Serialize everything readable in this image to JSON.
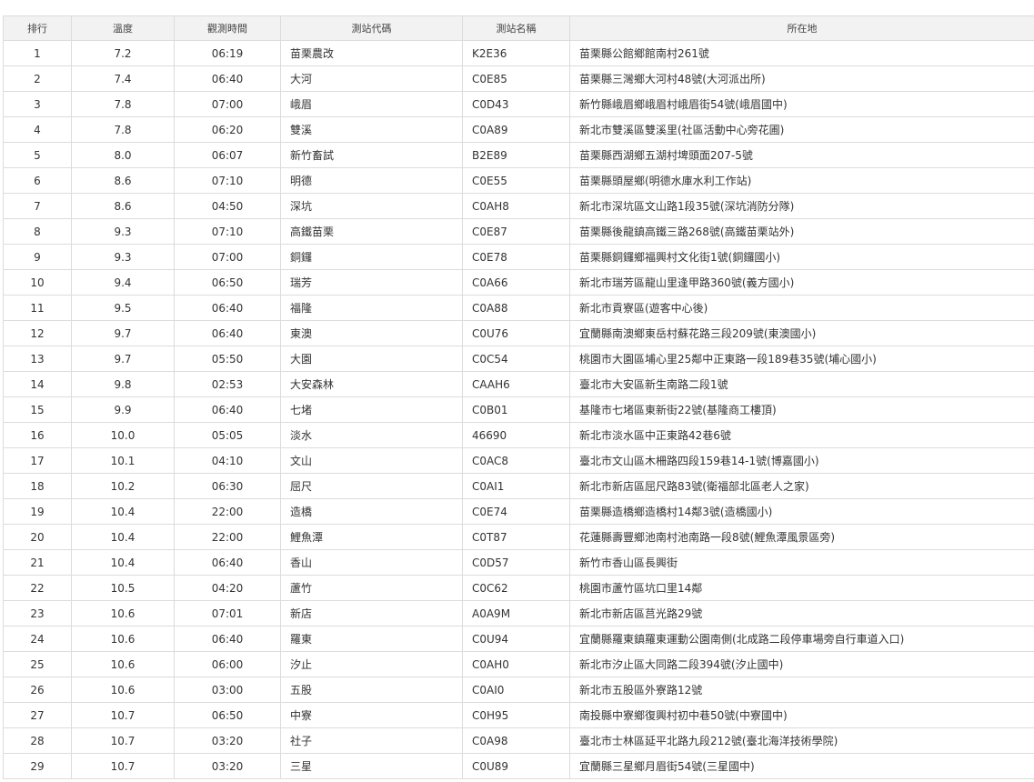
{
  "table": {
    "headers": [
      "排行",
      "溫度",
      "觀測時間",
      "測站代碼",
      "測站名稱",
      "所在地"
    ],
    "rows": [
      [
        "1",
        "7.2",
        "06:19",
        "苗栗農改",
        "K2E36",
        "苗栗縣公館鄉館南村261號"
      ],
      [
        "2",
        "7.4",
        "06:40",
        "大河",
        "C0E85",
        "苗栗縣三灣鄉大河村48號(大河派出所)"
      ],
      [
        "3",
        "7.8",
        "07:00",
        "峨眉",
        "C0D43",
        "新竹縣峨眉鄉峨眉村峨眉街54號(峨眉國中)"
      ],
      [
        "4",
        "7.8",
        "06:20",
        "雙溪",
        "C0A89",
        "新北市雙溪區雙溪里(社區活動中心旁花圃)"
      ],
      [
        "5",
        "8.0",
        "06:07",
        "新竹畜試",
        "B2E89",
        "苗栗縣西湖鄉五湖村埤頭面207-5號"
      ],
      [
        "6",
        "8.6",
        "07:10",
        "明德",
        "C0E55",
        "苗栗縣頭屋鄉(明德水庫水利工作站)"
      ],
      [
        "7",
        "8.6",
        "04:50",
        "深坑",
        "C0AH8",
        "新北市深坑區文山路1段35號(深坑消防分隊)"
      ],
      [
        "8",
        "9.3",
        "07:10",
        "高鐵苗栗",
        "C0E87",
        "苗栗縣後龍鎮高鐵三路268號(高鐵苗栗站外)"
      ],
      [
        "9",
        "9.3",
        "07:00",
        "銅鑼",
        "C0E78",
        "苗栗縣銅鑼鄉福興村文化街1號(銅鑼國小)"
      ],
      [
        "10",
        "9.4",
        "06:50",
        "瑞芳",
        "C0A66",
        "新北市瑞芳區龍山里逢甲路360號(義方國小)"
      ],
      [
        "11",
        "9.5",
        "06:40",
        "福隆",
        "C0A88",
        "新北市貢寮區(遊客中心後)"
      ],
      [
        "12",
        "9.7",
        "06:40",
        "東澳",
        "C0U76",
        "宜蘭縣南澳鄉東岳村蘇花路三段209號(東澳國小)"
      ],
      [
        "13",
        "9.7",
        "05:50",
        "大園",
        "C0C54",
        "桃園市大園區埔心里25鄰中正東路一段189巷35號(埔心國小)"
      ],
      [
        "14",
        "9.8",
        "02:53",
        "大安森林",
        "CAAH6",
        "臺北市大安區新生南路二段1號"
      ],
      [
        "15",
        "9.9",
        "06:40",
        "七堵",
        "C0B01",
        "基隆市七堵區東新街22號(基隆商工樓頂)"
      ],
      [
        "16",
        "10.0",
        "05:05",
        "淡水",
        "46690",
        "新北市淡水區中正東路42巷6號"
      ],
      [
        "17",
        "10.1",
        "04:10",
        "文山",
        "C0AC8",
        "臺北市文山區木柵路四段159巷14-1號(博嘉國小)"
      ],
      [
        "18",
        "10.2",
        "06:30",
        "屈尺",
        "C0AI1",
        "新北市新店區屈尺路83號(衛福部北區老人之家)"
      ],
      [
        "19",
        "10.4",
        "22:00",
        "造橋",
        "C0E74",
        "苗栗縣造橋鄉造橋村14鄰3號(造橋國小)"
      ],
      [
        "20",
        "10.4",
        "22:00",
        "鯉魚潭",
        "C0T87",
        "花蓮縣壽豐鄉池南村池南路一段8號(鯉魚潭風景區旁)"
      ],
      [
        "21",
        "10.4",
        "06:40",
        "香山",
        "C0D57",
        "新竹市香山區長興街"
      ],
      [
        "22",
        "10.5",
        "04:20",
        "蘆竹",
        "C0C62",
        "桃園市蘆竹區坑口里14鄰"
      ],
      [
        "23",
        "10.6",
        "07:01",
        "新店",
        "A0A9M",
        "新北市新店區莒光路29號"
      ],
      [
        "24",
        "10.6",
        "06:40",
        "羅東",
        "C0U94",
        "宜蘭縣羅東鎮羅東運動公園南側(北成路二段停車場旁自行車道入口)"
      ],
      [
        "25",
        "10.6",
        "06:00",
        "汐止",
        "C0AH0",
        "新北市汐止區大同路二段394號(汐止國中)"
      ],
      [
        "26",
        "10.6",
        "03:00",
        "五股",
        "C0AI0",
        "新北市五股區外寮路12號"
      ],
      [
        "27",
        "10.7",
        "06:50",
        "中寮",
        "C0H95",
        "南投縣中寮鄉復興村初中巷50號(中寮國中)"
      ],
      [
        "28",
        "10.7",
        "03:20",
        "社子",
        "C0A98",
        "臺北市士林區延平北路九段212號(臺北海洋技術學院)"
      ],
      [
        "29",
        "10.7",
        "03:20",
        "三星",
        "C0U89",
        "宜蘭縣三星鄉月眉街54號(三星國中)"
      ]
    ]
  }
}
